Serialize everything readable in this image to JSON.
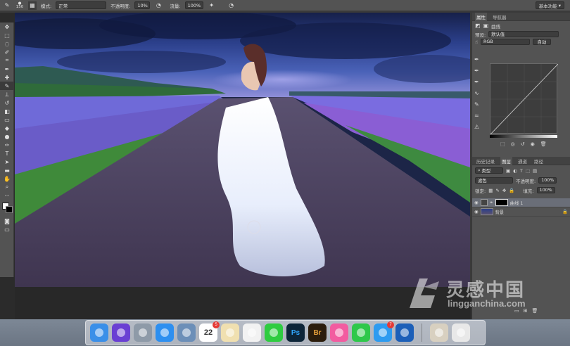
{
  "options_bar": {
    "brush_size": "150",
    "mode_label": "模式:",
    "mode_value": "正常",
    "opacity_label": "不透明度:",
    "opacity_value": "10%",
    "flow_label": "流量:",
    "flow_value": "100%",
    "workspace": "基本功能"
  },
  "properties": {
    "tabs": [
      "属性",
      "导航器"
    ],
    "title": "曲线",
    "preset_label": "预设:",
    "preset_value": "默认值",
    "channel_value": "RGB",
    "auto_label": "自动"
  },
  "layers_panel": {
    "tabs": [
      "历史记录",
      "图层",
      "通道",
      "路径"
    ],
    "filter_kind": "类型",
    "blend_mode": "滤色",
    "opacity_label": "不透明度:",
    "opacity_value": "100%",
    "lock_label": "锁定:",
    "fill_label": "填充:",
    "fill_value": "100%",
    "layers": [
      {
        "name": "曲线 1"
      },
      {
        "name": "背景"
      }
    ]
  },
  "dock": {
    "items": [
      {
        "icon": "finder-icon",
        "label": "",
        "color": "#3a8fe8"
      },
      {
        "icon": "siri-icon",
        "label": "",
        "color": "#6a3fd3"
      },
      {
        "icon": "launchpad-icon",
        "label": "",
        "color": "#8e9aa8"
      },
      {
        "icon": "safari-icon",
        "label": "",
        "color": "#2d8ff0"
      },
      {
        "icon": "preview-icon",
        "label": "",
        "color": "#6c8fb8"
      },
      {
        "icon": "calendar-icon",
        "label": "22",
        "color": "#ffffff",
        "badge": "5"
      },
      {
        "icon": "photos-icon",
        "label": "",
        "color": "#f0e0b0"
      },
      {
        "icon": "qq-icon",
        "label": "",
        "color": "#f2f2f2"
      },
      {
        "icon": "wechat-icon",
        "label": "",
        "color": "#2ecc40"
      },
      {
        "icon": "photoshop-icon",
        "label": "Ps",
        "color": "#0d2538"
      },
      {
        "icon": "bridge-icon",
        "label": "Br",
        "color": "#2b1d0c"
      },
      {
        "icon": "itunes-icon",
        "label": "",
        "color": "#f25ca0"
      },
      {
        "icon": "music-icon",
        "label": "",
        "color": "#2ec84a"
      },
      {
        "icon": "appstore-icon",
        "label": "",
        "color": "#2d9bf0",
        "badge": "7"
      },
      {
        "icon": "quicktime-icon",
        "label": "",
        "color": "#1c5fb8"
      },
      {
        "icon": "image-folder-icon",
        "label": "",
        "color": "#d8d0c0"
      },
      {
        "icon": "trash-icon",
        "label": "",
        "color": "#e8e8e8"
      }
    ]
  },
  "watermark": {
    "cn": "灵感中国",
    "en": "lingganchina.com"
  }
}
